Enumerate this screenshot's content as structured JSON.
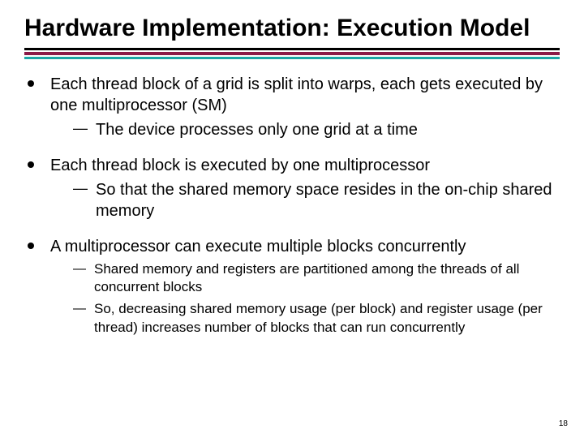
{
  "title": "Hardware Implementation: Execution Model",
  "bullets": [
    {
      "text": "Each thread block of a grid is split into warps, each gets executed by one multiprocessor (SM)",
      "subs": [
        {
          "text": "The device processes only one grid at a time",
          "small": false
        }
      ]
    },
    {
      "text": "Each thread block is executed by one multiprocessor",
      "subs": [
        {
          "text": "So that the shared memory space resides in the on-chip shared memory",
          "small": false
        }
      ]
    },
    {
      "text": "A multiprocessor can execute multiple blocks concurrently",
      "subs": [
        {
          "text": "Shared memory and registers are partitioned among the threads of all concurrent blocks",
          "small": true
        },
        {
          "text": "So, decreasing shared memory usage (per block) and register usage (per thread) increases number of blocks that can run concurrently",
          "small": true
        }
      ]
    }
  ],
  "page_number": "18"
}
